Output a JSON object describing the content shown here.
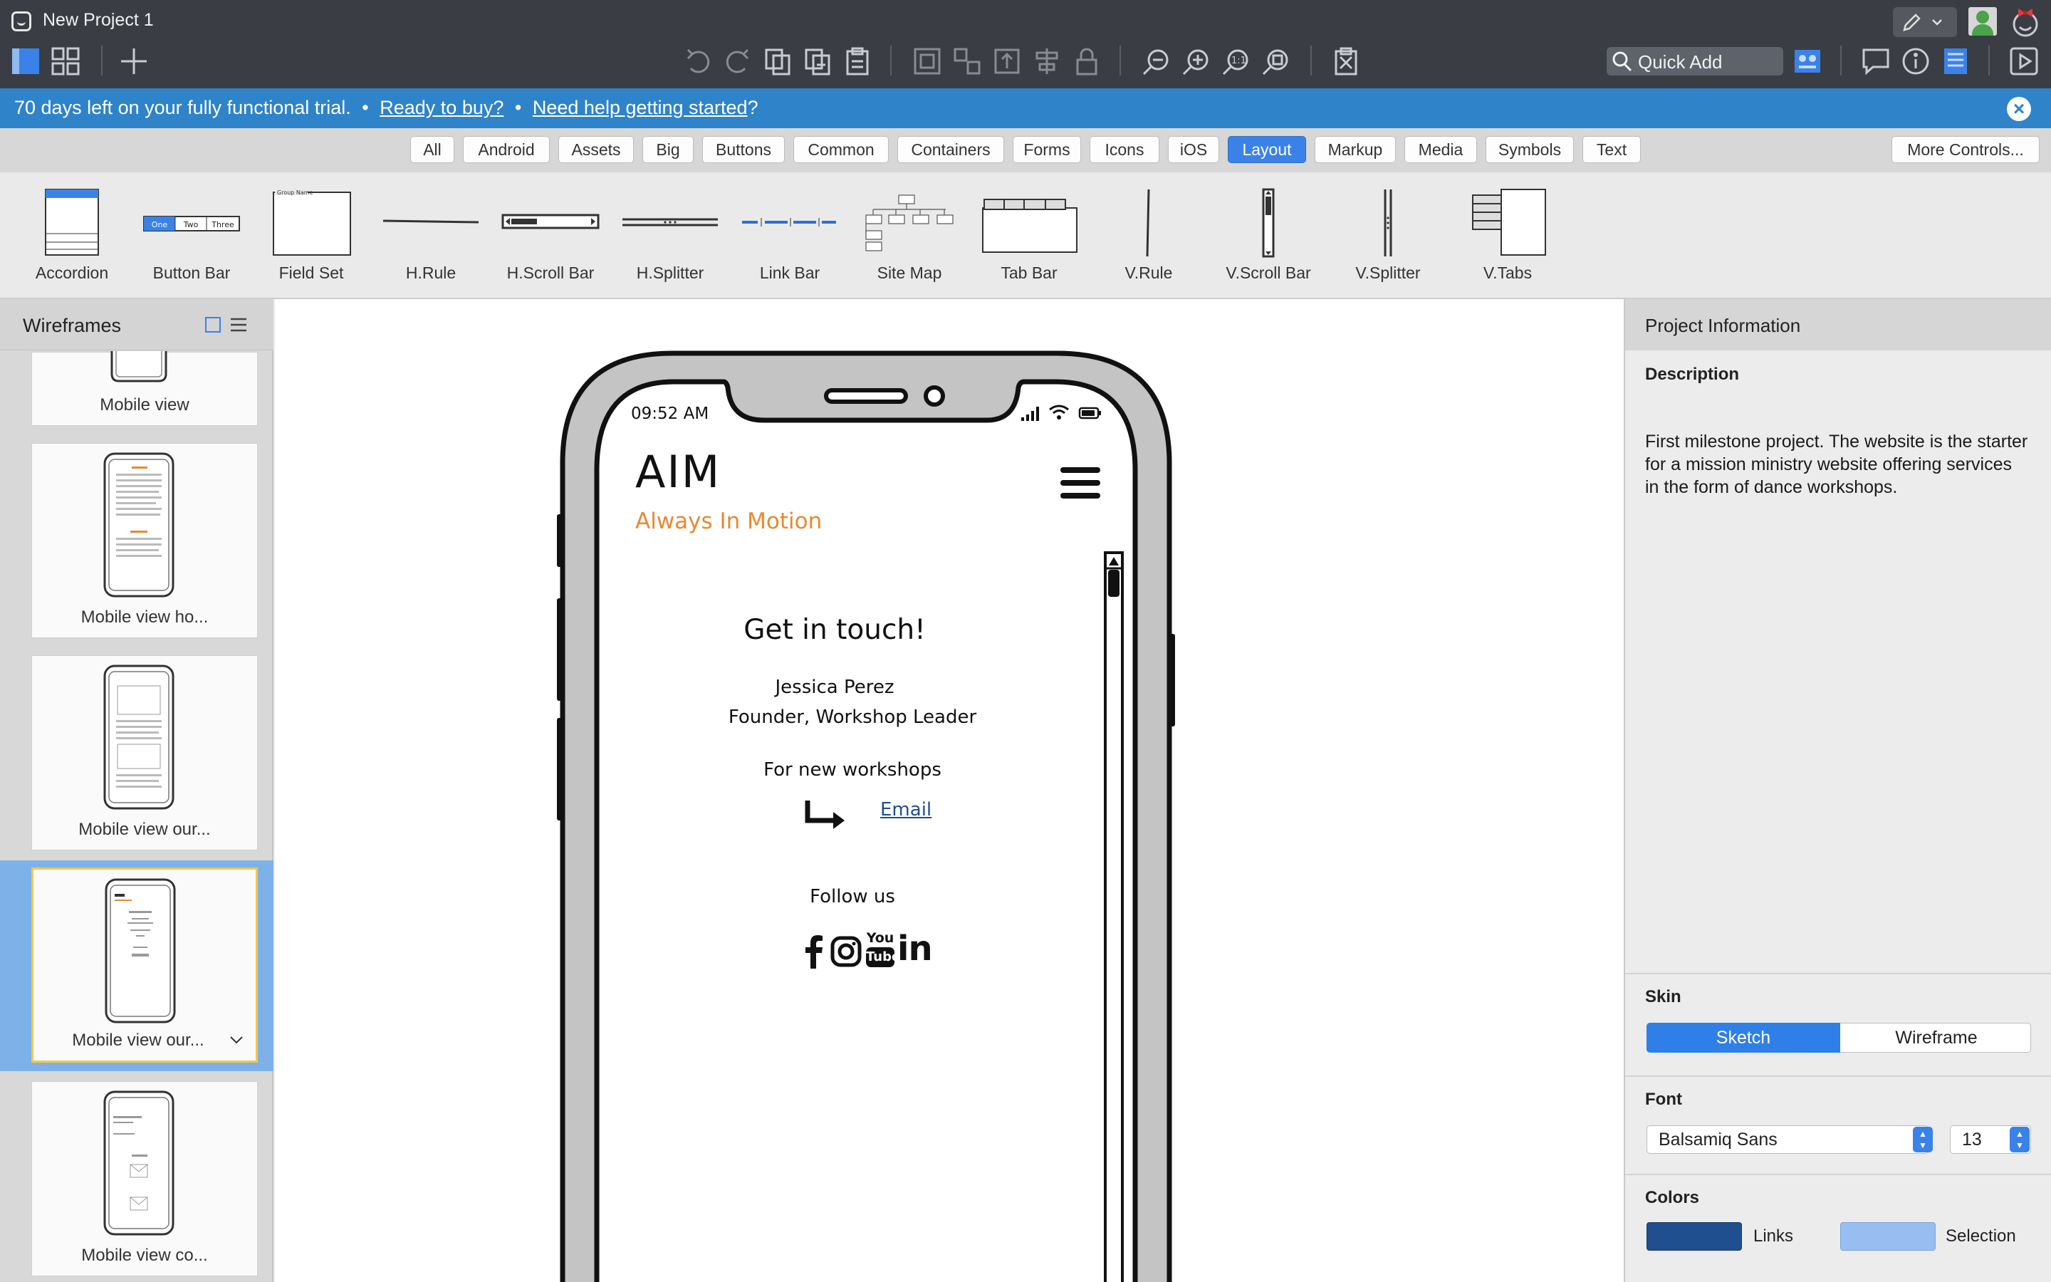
{
  "window": {
    "title": "New Project 1"
  },
  "toolbar": {
    "quick_add_label": "Quick Add"
  },
  "trial_banner": {
    "text": "70 days left on your fully functional trial.",
    "sep1": "•",
    "ready_link": "Ready to buy?",
    "sep2": "•",
    "help_link": "Need help getting started",
    "help_suffix": "?"
  },
  "categories": {
    "items": [
      "All",
      "Android",
      "Assets",
      "Big",
      "Buttons",
      "Common",
      "Containers",
      "Forms",
      "Icons",
      "iOS",
      "Layout",
      "Markup",
      "Media",
      "Symbols",
      "Text"
    ],
    "active": "Layout",
    "more_label": "More Controls..."
  },
  "controls": {
    "items": [
      "Accordion",
      "Button Bar",
      "Field Set",
      "H.Rule",
      "H.Scroll Bar",
      "H.Splitter",
      "Link Bar",
      "Site Map",
      "Tab Bar",
      "V.Rule",
      "V.Scroll Bar",
      "V.Splitter",
      "V.Tabs"
    ],
    "button_bar_labels": [
      "One",
      "Two",
      "Three"
    ],
    "field_set_caption": "Group Name"
  },
  "wireframes": {
    "title": "Wireframes",
    "items": [
      {
        "label": "Mobile view"
      },
      {
        "label": "Mobile view ho..."
      },
      {
        "label": "Mobile view our..."
      },
      {
        "label": "Mobile view our...",
        "selected": true
      },
      {
        "label": "Mobile view co..."
      }
    ]
  },
  "phone": {
    "time": "09:52 AM",
    "brand": "AIM",
    "tagline": "Always In Motion",
    "heading": "Get in touch!",
    "name": "Jessica Perez",
    "role": "Founder, Workshop Leader",
    "workshops_text": "For new workshops",
    "email_link": "Email",
    "follow_text": "Follow us",
    "youtube_top": "You",
    "youtube_bottom": "Tube",
    "linkedin_text": "in"
  },
  "project_info": {
    "title": "Project Information",
    "description_label": "Description",
    "description": "First milestone project. The website is the starter for a mission ministry website offering services in the form of dance workshops.",
    "skin_label": "Skin",
    "skin_options": [
      "Sketch",
      "Wireframe"
    ],
    "skin_selected": "Sketch",
    "font_label": "Font",
    "font_value": "Balsamiq Sans",
    "font_size": "13",
    "colors_label": "Colors",
    "links_label": "Links",
    "selection_label": "Selection",
    "links_color": "#1f4f8f",
    "selection_color": "#98bdf0",
    "accent_color": "#2f83c9",
    "tagline_color": "#e8892e"
  }
}
